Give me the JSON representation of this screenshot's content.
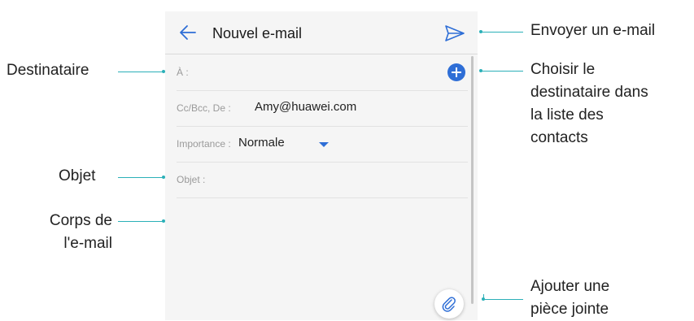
{
  "header": {
    "title": "Nouvel e-mail",
    "back_icon": "arrow-left-icon",
    "send_icon": "send-icon"
  },
  "fields": {
    "to_label": "À :",
    "cc_label": "Cc/Bcc, De :",
    "cc_value": "Amy@huawei.com",
    "importance_label": "Importance :",
    "importance_value": "Normale",
    "subject_label": "Objet :"
  },
  "icons": {
    "add_contact": "add-circle-icon",
    "dropdown": "dropdown-arrow-icon",
    "attachment": "paperclip-icon"
  },
  "colors": {
    "accent": "#2e6ed6",
    "leader_line": "#2bb0b8"
  },
  "callouts": {
    "send": "Envoyer un e-mail",
    "choose_recipient": [
      "Choisir le",
      "destinataire dans",
      "la liste des",
      "contacts"
    ],
    "recipient": "Destinataire",
    "subject": "Objet",
    "body": [
      "Corps de",
      "l'e-mail"
    ],
    "attach": [
      "Ajouter une",
      "pièce jointe"
    ]
  }
}
